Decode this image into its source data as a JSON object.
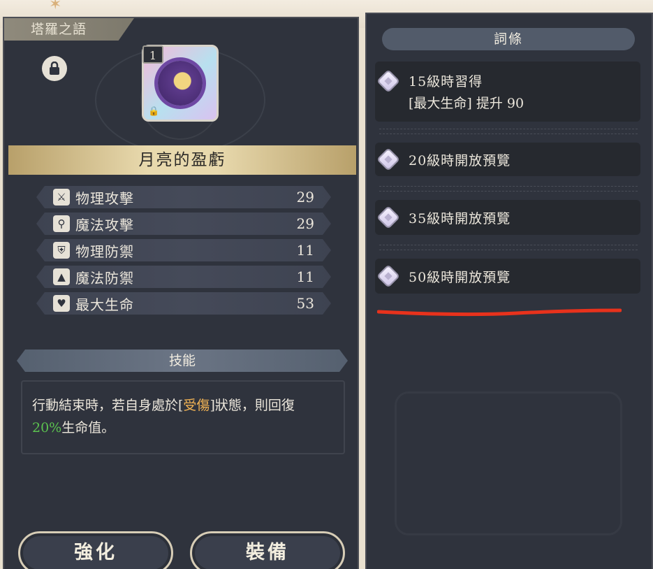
{
  "left_panel": {
    "title": "塔羅之語",
    "card": {
      "level_badge": "1",
      "icon": "moon-flower-icon"
    },
    "item_name": "月亮的盈虧",
    "stats": [
      {
        "icon": "sword-icon",
        "icon_glyph": "⚔",
        "label": "物理攻擊",
        "value": "29"
      },
      {
        "icon": "wand-icon",
        "icon_glyph": "⚲",
        "label": "魔法攻擊",
        "value": "29"
      },
      {
        "icon": "shield-icon",
        "icon_glyph": "⛨",
        "label": "物理防禦",
        "value": "11"
      },
      {
        "icon": "witch-hat-icon",
        "icon_glyph": "▲",
        "label": "魔法防禦",
        "value": "11"
      },
      {
        "icon": "heart-icon",
        "icon_glyph": "♥",
        "label": "最大生命",
        "value": "53"
      }
    ],
    "skill": {
      "header": "技能",
      "part1": "行動結束時，若自身處於[",
      "keyword": "受傷",
      "part2": "]狀態，則回復",
      "percent": "20%",
      "part3": "生命值。"
    },
    "buttons": {
      "enhance": "強化",
      "equip": "裝備"
    }
  },
  "right_panel": {
    "header": "詞條",
    "entries": [
      {
        "title": "15級時習得",
        "detail": "[最大生命] 提升 90"
      },
      {
        "title": "20級時開放預覽"
      },
      {
        "title": "35級時開放預覽"
      },
      {
        "title": "50級時開放預覽"
      }
    ]
  },
  "colors": {
    "panel": "#2f333d",
    "accent_gold": "#e8d9ad",
    "highlight_orange": "#f0b254",
    "highlight_green": "#5bc24f",
    "annotation_red": "#e8321c"
  }
}
